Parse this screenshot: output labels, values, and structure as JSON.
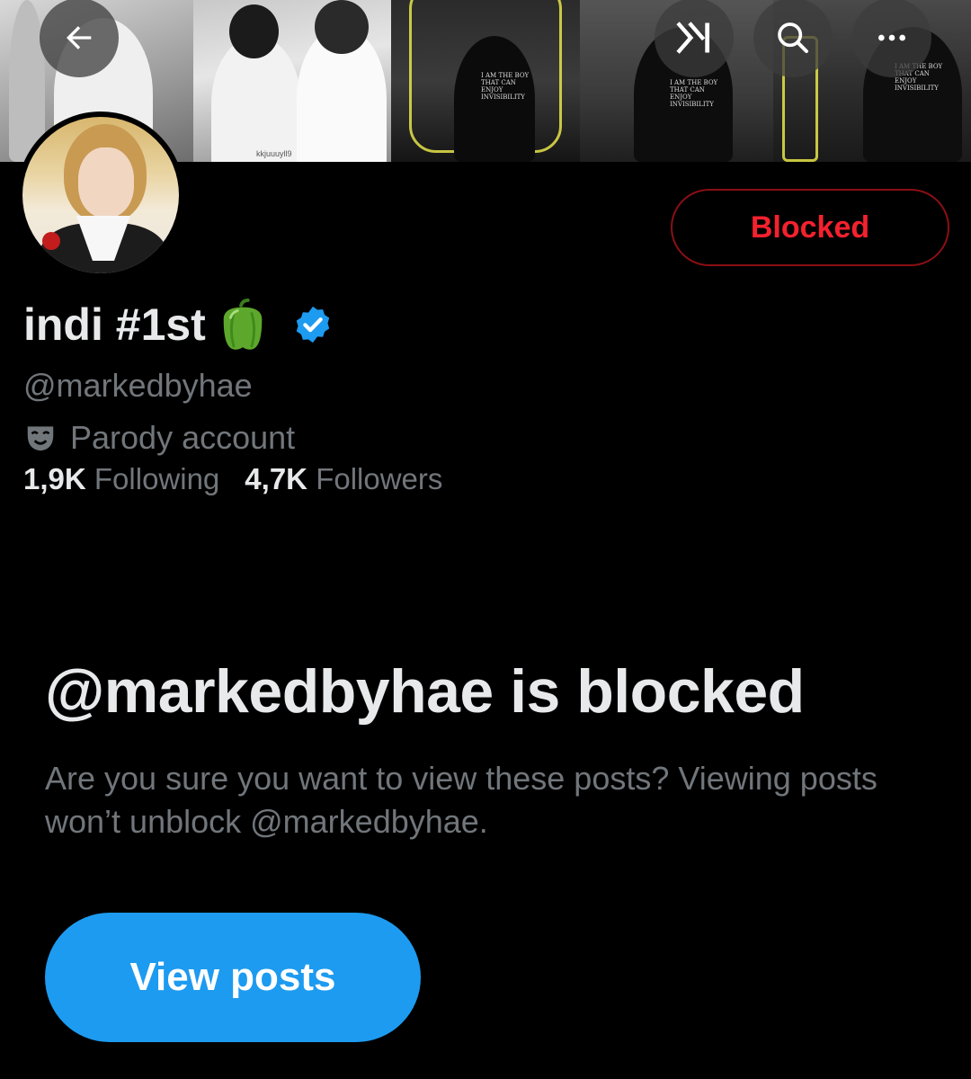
{
  "header": {
    "back_icon": "arrow-left-icon",
    "xai_icon": "grok-xai-icon",
    "search_icon": "search-icon",
    "more_icon": "more-horizontal-icon"
  },
  "banner": {
    "watermark": "kkjuuuyll9",
    "shirt_text": "I AM THE BOY\nTHAT CAN\nENJOY\nINVISIBILITY"
  },
  "profile": {
    "display_name": "indi #1st",
    "name_emoji": "bell-pepper-icon",
    "verified": "verified-badge-icon",
    "handle": "@markedbyhae",
    "label_icon": "parody-mask-icon",
    "label_text": "Parody account",
    "following_count": "1,9K",
    "following_label": "Following",
    "followers_count": "4,7K",
    "followers_label": "Followers"
  },
  "actions": {
    "blocked_label": "Blocked"
  },
  "blocked_notice": {
    "title": "@markedbyhae is blocked",
    "description": "Are you sure you want to view these posts? Viewing posts won’t unblock @markedbyhae.",
    "button_label": "View posts"
  },
  "colors": {
    "background": "#000000",
    "primary_text": "#e7e9ea",
    "secondary_text": "#71767b",
    "danger": "#f4212e",
    "accent": "#1d9bf0"
  }
}
